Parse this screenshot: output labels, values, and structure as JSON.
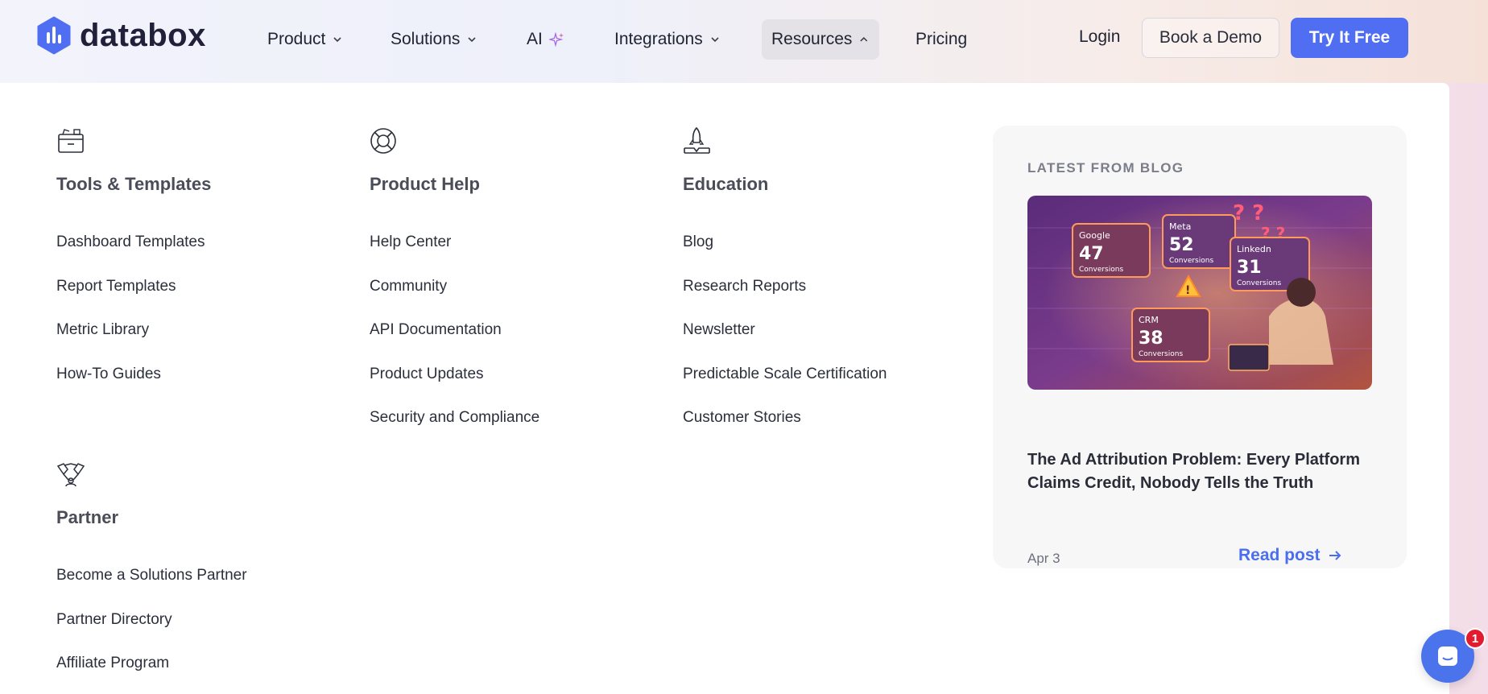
{
  "brand": {
    "name": "databox",
    "color": "#4f6ef2"
  },
  "nav": {
    "items": [
      {
        "label": "Product",
        "has_dropdown": true
      },
      {
        "label": "Solutions",
        "has_dropdown": true
      },
      {
        "label": "AI",
        "icon": "sparkle-icon"
      },
      {
        "label": "Integrations",
        "has_dropdown": true
      },
      {
        "label": "Resources",
        "has_dropdown": true,
        "expanded": true
      },
      {
        "label": "Pricing"
      }
    ],
    "login": "Login",
    "demo": "Book a Demo",
    "try": "Try It Free"
  },
  "menu": {
    "tools": {
      "title": "Tools & Templates",
      "icon": "toolbox-icon",
      "links": [
        "Dashboard Templates",
        "Report Templates",
        "Metric Library",
        "How-To Guides"
      ]
    },
    "help": {
      "title": "Product Help",
      "icon": "lifebuoy-icon",
      "links": [
        "Help Center",
        "Community",
        "API Documentation",
        "Product Updates",
        "Security and Compliance"
      ]
    },
    "education": {
      "title": "Education",
      "icon": "rocket-icon",
      "links": [
        "Blog",
        "Research Reports",
        "Newsletter",
        "Predictable Scale Certification",
        "Customer Stories"
      ]
    },
    "partner": {
      "title": "Partner",
      "icon": "handshake-icon",
      "links": [
        "Become a Solutions Partner",
        "Partner Directory",
        "Affiliate Program"
      ]
    }
  },
  "blog": {
    "label": "LATEST FROM BLOG",
    "title": "The Ad Attribution Problem: Every Platform Claims Credit, Nobody Tells the Truth",
    "date": "Apr 3",
    "read": "Read post",
    "image": {
      "cards": [
        {
          "platform": "Google",
          "value": "47",
          "unit": "Conversions"
        },
        {
          "platform": "Meta",
          "value": "52",
          "unit": "Conversions"
        },
        {
          "platform": "Linkedn",
          "value": "31",
          "unit": "Conversions"
        },
        {
          "platform": "CRM",
          "value": "38",
          "unit": "Conversions"
        }
      ]
    }
  },
  "chat": {
    "badge": "1"
  }
}
